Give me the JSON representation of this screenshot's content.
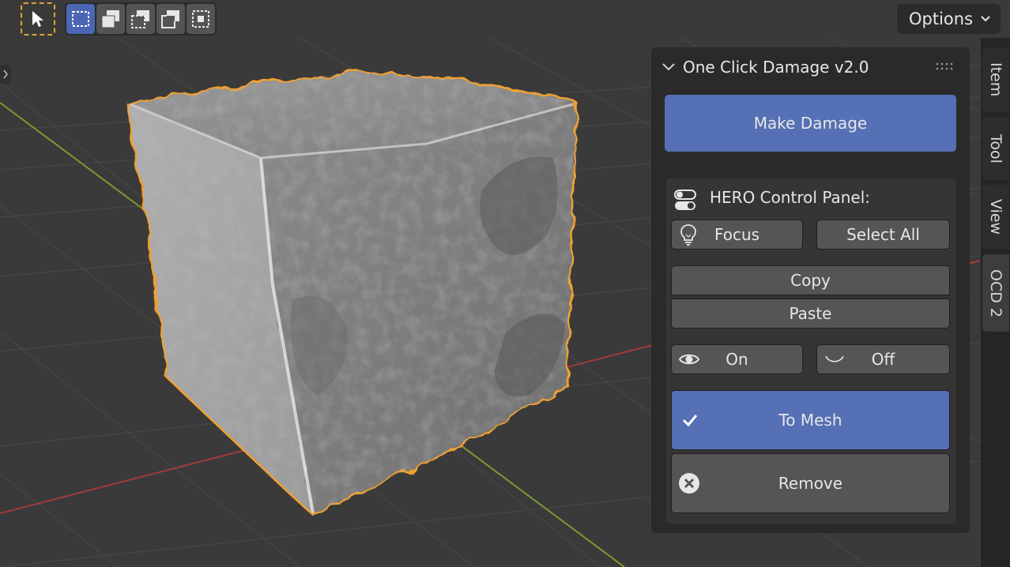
{
  "toolbar": {
    "active_tool": "select-cursor",
    "modes": [
      {
        "icon": "select-new-icon",
        "active": true
      },
      {
        "icon": "select-extend-icon",
        "active": false
      },
      {
        "icon": "select-subtract-icon",
        "active": false
      },
      {
        "icon": "select-invert-icon",
        "active": false
      },
      {
        "icon": "select-intersect-icon",
        "active": false
      }
    ],
    "options_label": "Options"
  },
  "panel": {
    "title": "One Click Damage v2.0",
    "make_damage_label": "Make Damage",
    "hero": {
      "title": "HERO Control Panel:",
      "focus_label": "Focus",
      "select_all_label": "Select All",
      "copy_label": "Copy",
      "paste_label": "Paste",
      "on_label": "On",
      "off_label": "Off",
      "to_mesh_label": "To Mesh",
      "remove_label": "Remove"
    }
  },
  "sidebar_tabs": [
    {
      "label": "Item",
      "active": false
    },
    {
      "label": "Tool",
      "active": false
    },
    {
      "label": "View",
      "active": false
    },
    {
      "label": "OCD 2",
      "active": true
    }
  ],
  "colors": {
    "accent_blue": "#5570b4",
    "selection_outline": "#f0a030",
    "x_axis": "#a33a3a",
    "y_axis": "#7a9a30"
  }
}
